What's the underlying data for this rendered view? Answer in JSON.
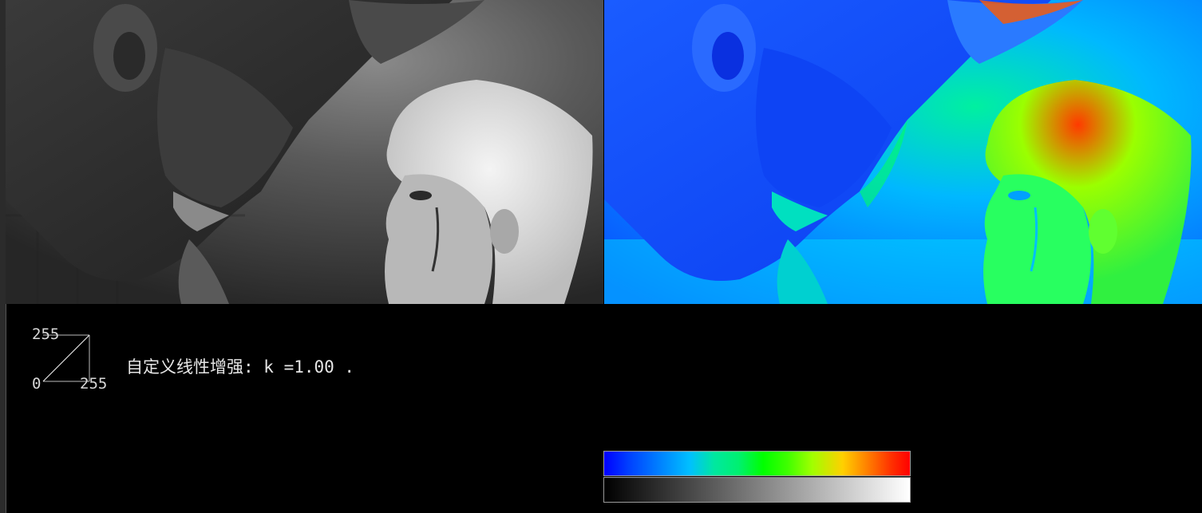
{
  "curve": {
    "top_label": "255",
    "origin_label": "0",
    "right_label": "255"
  },
  "status": {
    "text": "自定义线性增强: k =1.00 ."
  },
  "images": {
    "left": "grayscale-image",
    "right": "jet-pseudocolor-image"
  },
  "colorbars": {
    "top": {
      "name": "jet-colormap",
      "colors": [
        "#0000ff",
        "#00c0ff",
        "#00ff00",
        "#ffd000",
        "#ff0000"
      ]
    },
    "bottom": {
      "name": "grayscale-colormap",
      "colors": [
        "#000000",
        "#ffffff"
      ]
    }
  },
  "colors": {
    "background": "#000000",
    "text": "#e6e6e6"
  }
}
